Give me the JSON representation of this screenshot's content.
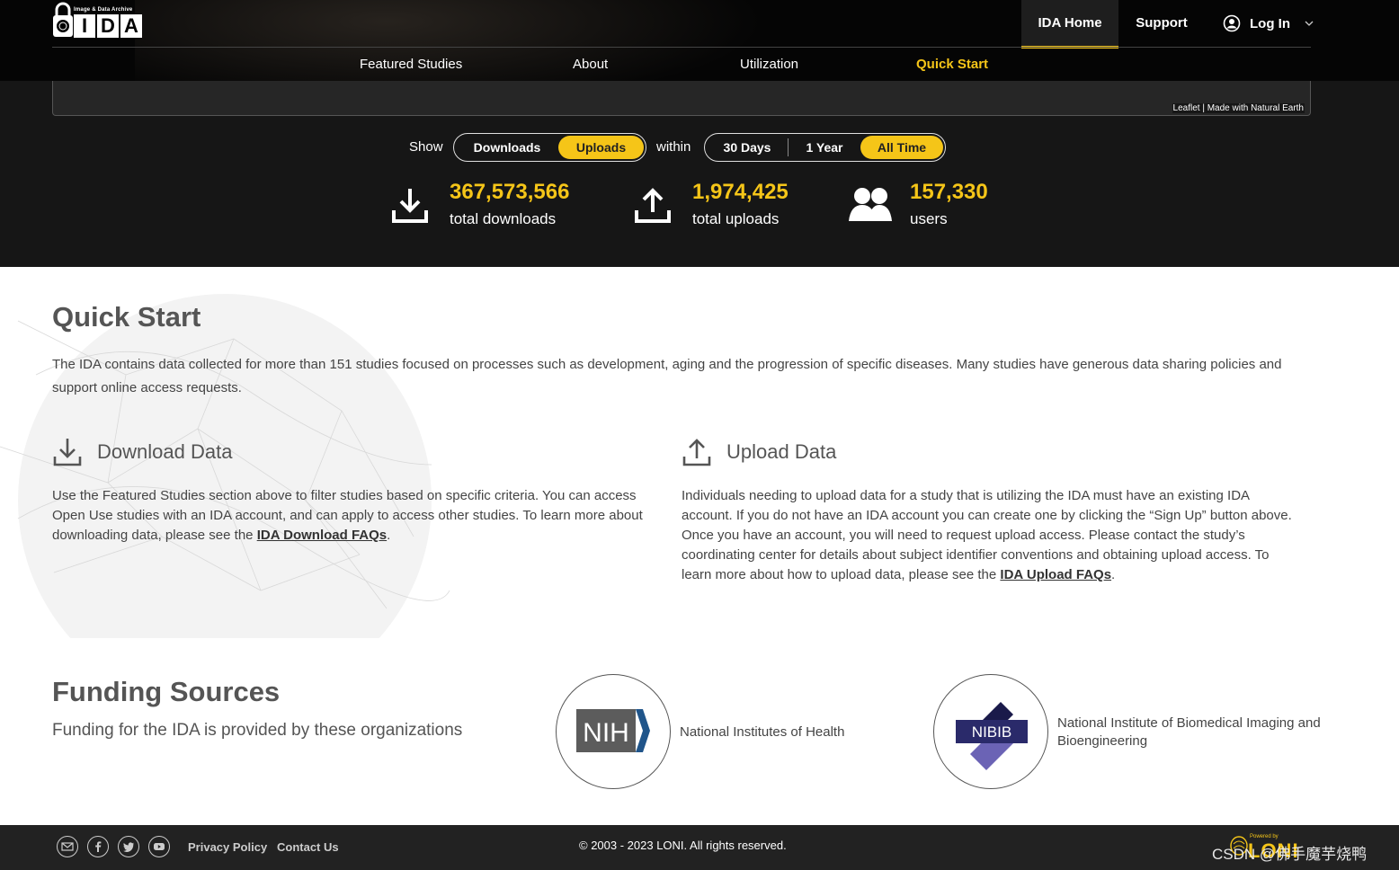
{
  "logo": {
    "tagline": "Image & Data Archive",
    "letters": [
      "I",
      "D",
      "A"
    ]
  },
  "top_nav": {
    "home": "IDA Home",
    "support": "Support",
    "login": "Log In"
  },
  "sub_nav": [
    "Featured Studies",
    "About",
    "Utilization",
    "Quick Start"
  ],
  "map": {
    "attribution": "Leaflet | Made with Natural Earth"
  },
  "filters": {
    "show_label": "Show",
    "show_options": [
      "Downloads",
      "Uploads"
    ],
    "show_selected": "Uploads",
    "within_label": "within",
    "range_options": [
      "30 Days",
      "1 Year",
      "All Time"
    ],
    "range_selected": "All Time"
  },
  "stats": [
    {
      "value": "367,573,566",
      "label": "total downloads",
      "icon": "download-icon"
    },
    {
      "value": "1,974,425",
      "label": "total uploads",
      "icon": "upload-icon"
    },
    {
      "value": "157,330",
      "label": "users",
      "icon": "users-icon"
    }
  ],
  "quick_start": {
    "title": "Quick Start",
    "intro": "The IDA contains data collected for more than 151 studies focused on processes such as development, aging and the progression of specific diseases. Many studies have generous data sharing policies and support online access requests.",
    "download": {
      "heading": "Download Data",
      "text": "Use the Featured Studies section above to filter studies based on specific criteria. You can access Open Use studies with an IDA account, and can apply to access other studies. To learn more about downloading data, please see the ",
      "link": "IDA Download FAQs",
      "end": "."
    },
    "upload": {
      "heading": "Upload Data",
      "text": "Individuals needing to upload data for a study that is utilizing the IDA must have an existing IDA account. If you do not have an IDA account you can create one by clicking the “Sign Up” button above. Once you have an account, you will need to request upload access. Please contact the study’s coordinating center for details about subject identifier conventions and obtaining upload access. To learn more about how to upload data, please see the ",
      "link": "IDA Upload FAQs",
      "end": "."
    }
  },
  "funding": {
    "title": "Funding Sources",
    "subtitle": "Funding for the IDA is provided by these organizations",
    "orgs": [
      {
        "logo_text": "NIH",
        "name": "National Institutes of Health"
      },
      {
        "logo_text": "NIBIB",
        "name": "National Institute of Biomedical Imaging and Bioengineering"
      }
    ]
  },
  "footer": {
    "links": [
      "Privacy Policy",
      "Contact Us"
    ],
    "copyright": "© 2003 - 2023 LONI. All rights reserved.",
    "powered_by": "Powered by",
    "brand": "LONI",
    "watermark": "CSDN @佛手魔芋烧鸭"
  },
  "colors": {
    "accent": "#f5c518",
    "dark": "#161616",
    "header": "#050505",
    "footer": "#222222",
    "nibib_purple": "#6b63b5"
  }
}
